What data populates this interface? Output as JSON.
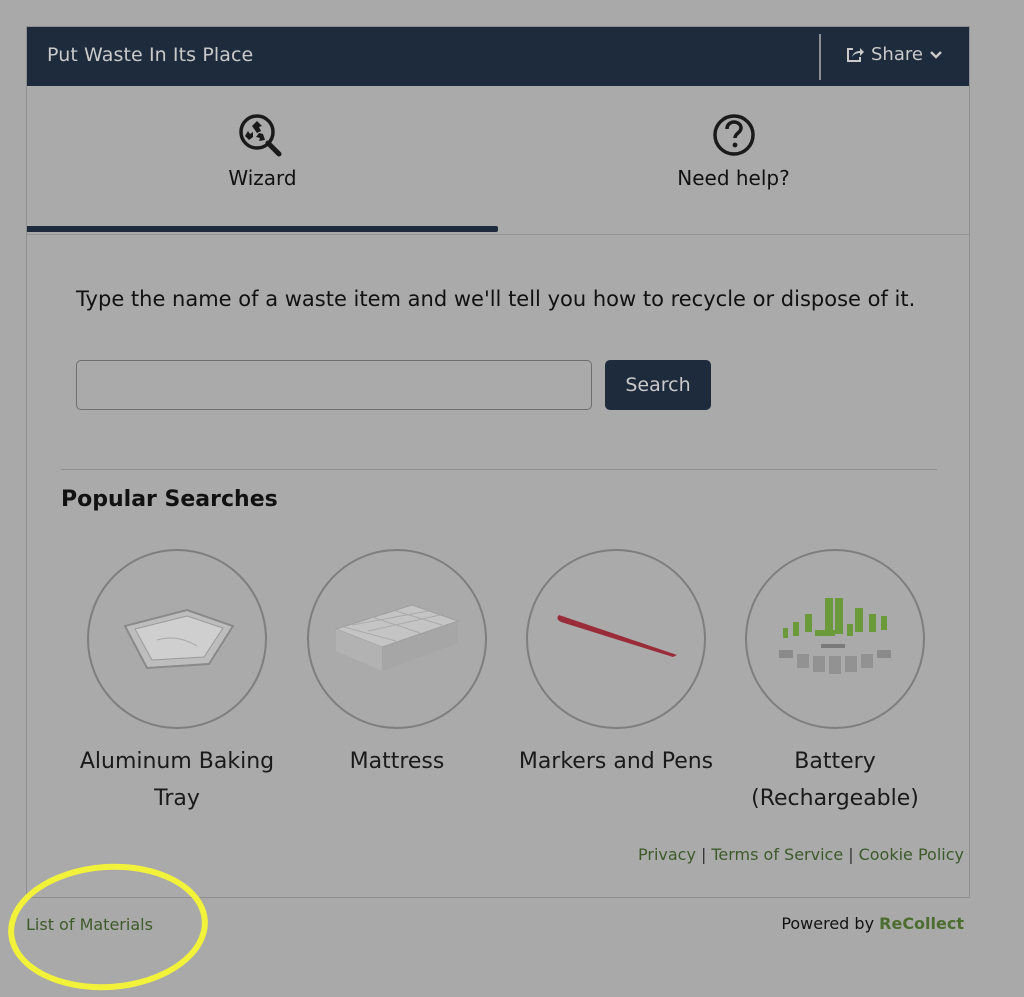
{
  "header": {
    "title": "Put Waste In Its Place",
    "share_label": "Share"
  },
  "tabs": [
    {
      "label": "Wizard",
      "icon": "recycle-search-icon",
      "active": true
    },
    {
      "label": "Need help?",
      "icon": "question-circle-icon",
      "active": false
    }
  ],
  "wizard": {
    "prompt": "Type the name of a waste item and we'll tell you how to recycle or dispose of it.",
    "search_value": "",
    "search_placeholder": "",
    "search_button": "Search"
  },
  "popular": {
    "title": "Popular Searches",
    "items": [
      {
        "label": "Aluminum Baking Tray",
        "image": "aluminum-tray-image"
      },
      {
        "label": "Mattress",
        "image": "mattress-image"
      },
      {
        "label": "Markers and Pens",
        "image": "marker-image"
      },
      {
        "label": "Battery (Rechargeable)",
        "image": "batteries-image"
      }
    ]
  },
  "footer": {
    "privacy": "Privacy",
    "separator": "|",
    "terms": "Terms of Service",
    "cookie": "Cookie Policy",
    "list_of_materials": "List of Materials",
    "powered_by": "Powered by",
    "brand": "ReCollect"
  },
  "colors": {
    "brand_navy": "#1e2b3d",
    "link_green": "#3d5a2a",
    "annotation_yellow": "#f2f23a"
  }
}
